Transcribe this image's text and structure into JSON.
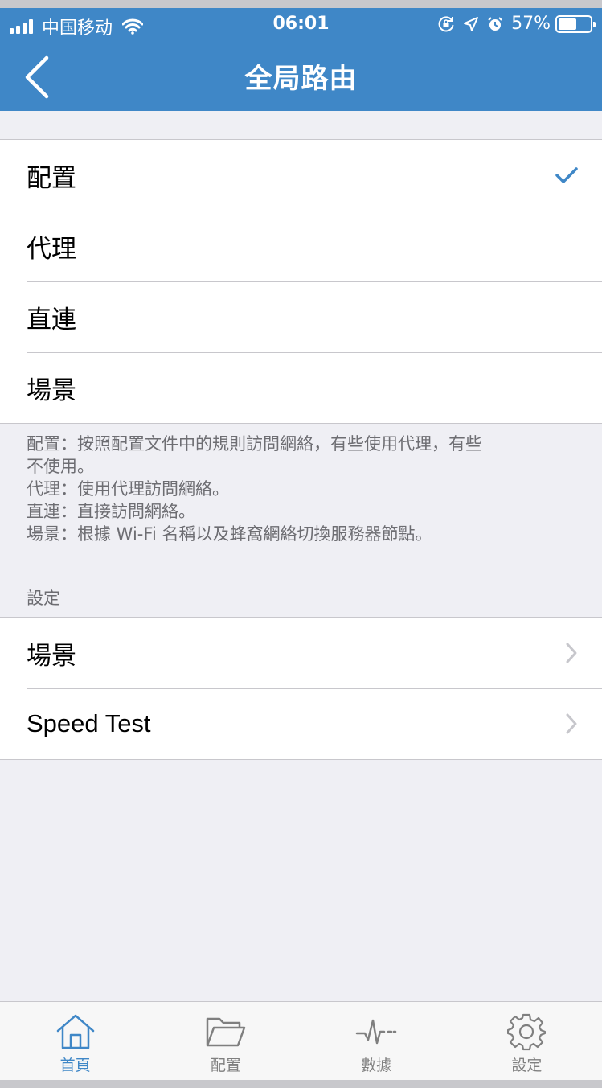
{
  "status_bar": {
    "carrier": "中国移动",
    "time": "06:01",
    "battery_percent": "57%",
    "battery_level": 0.57
  },
  "nav": {
    "title": "全局路由",
    "back_icon": "chevron-left-icon"
  },
  "routing_options": [
    {
      "label": "配置",
      "selected": true
    },
    {
      "label": "代理",
      "selected": false
    },
    {
      "label": "直連",
      "selected": false
    },
    {
      "label": "場景",
      "selected": false
    }
  ],
  "description": [
    "配置：按照配置文件中的規則訪問網絡，有些使用代理，有些",
    "不使用。",
    "代理：使用代理訪問網絡。",
    "直連：直接訪問網絡。",
    "場景：根據 Wi-Fi 名稱以及蜂窩網絡切換服務器節點。"
  ],
  "settings": {
    "header": "設定",
    "items": [
      {
        "label": "場景"
      },
      {
        "label": "Speed Test"
      }
    ]
  },
  "tabbar": {
    "items": [
      {
        "label": "首頁",
        "icon": "home-icon",
        "active": true
      },
      {
        "label": "配置",
        "icon": "folder-icon",
        "active": false
      },
      {
        "label": "數據",
        "icon": "pulse-icon",
        "active": false
      },
      {
        "label": "設定",
        "icon": "gear-icon",
        "active": false
      }
    ]
  },
  "colors": {
    "accent": "#3f87c7",
    "background": "#efeff4",
    "inactive_tab": "#7f7f7f"
  }
}
